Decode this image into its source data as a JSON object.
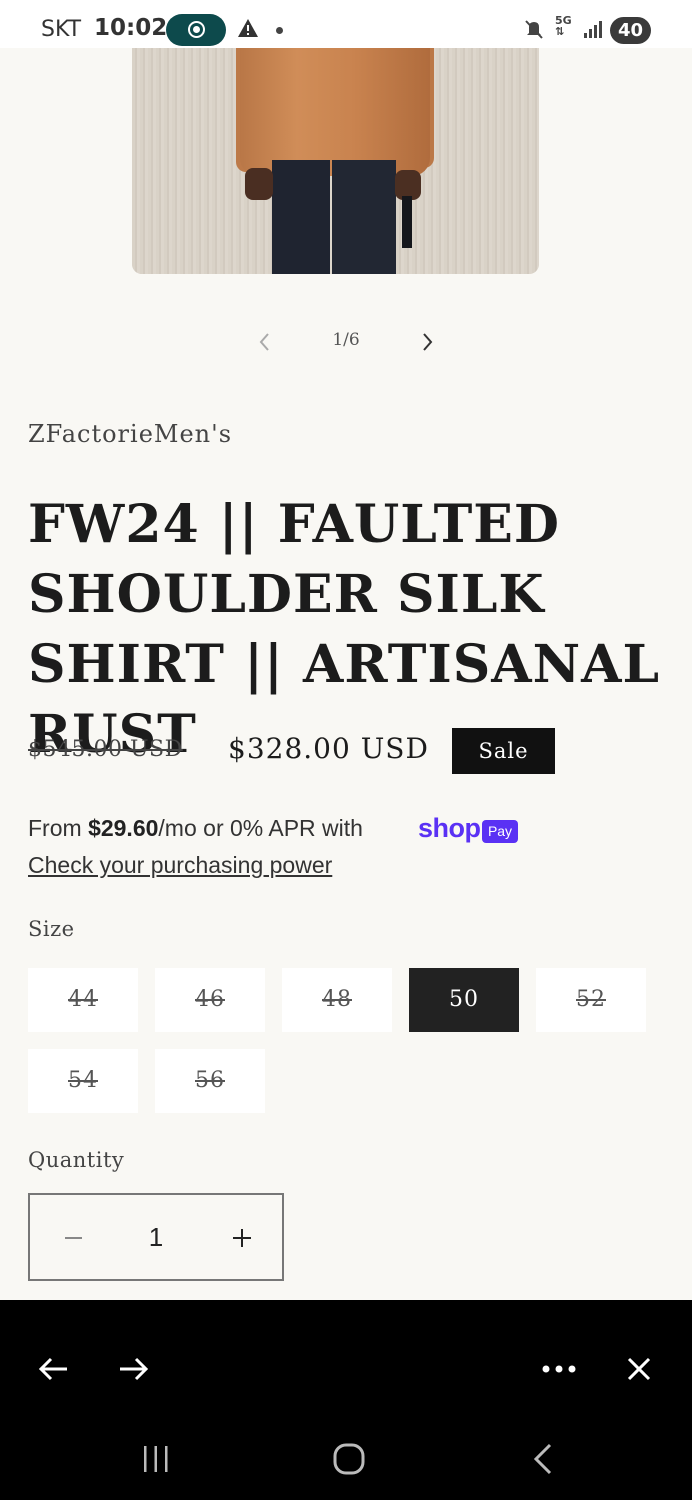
{
  "status_bar": {
    "carrier": "SKT",
    "time": "10:02",
    "network": "5G",
    "battery": "40",
    "icons": [
      "screen-record-icon",
      "warning-icon",
      "notification-dot-icon",
      "mute-icon",
      "5g-icon",
      "signal-icon",
      "battery-icon"
    ]
  },
  "gallery": {
    "counter": "1/6",
    "image_alt": "Model wearing rust silk shirt",
    "prev_icon": "chevron-left-icon",
    "next_icon": "chevron-right-icon"
  },
  "product": {
    "vendor": "ZFactorieMen's",
    "title": "FW24 || FAULTED SHOULDER SILK SHIRT || ARTISANAL RUST",
    "price_regular": "$545.00 USD",
    "price_sale": "$328.00 USD",
    "sale_badge": "Sale"
  },
  "shop_pay": {
    "text_prefix": "From ",
    "amount": "$29.60",
    "text_suffix": "/mo or 0% APR with",
    "brand": "shop",
    "badge": "Pay",
    "link": "Check your purchasing power"
  },
  "size": {
    "label": "Size",
    "options": [
      {
        "value": "44",
        "available": false
      },
      {
        "value": "46",
        "available": false
      },
      {
        "value": "48",
        "available": false
      },
      {
        "value": "50",
        "available": true,
        "selected": true
      },
      {
        "value": "52",
        "available": false
      },
      {
        "value": "54",
        "available": false
      },
      {
        "value": "56",
        "available": false
      }
    ]
  },
  "quantity": {
    "label": "Quantity",
    "value": "1"
  },
  "browser_toolbar": {
    "icons": [
      "back-arrow-icon",
      "forward-arrow-icon",
      "more-icon",
      "close-icon"
    ]
  },
  "system_nav": {
    "icons": [
      "recents-icon",
      "home-icon",
      "back-icon"
    ]
  },
  "colors": {
    "background": "#f9f8f4",
    "sale_badge": "#111111",
    "shop_pay_brand": "#5a31f4",
    "selected_size": "#222222"
  }
}
